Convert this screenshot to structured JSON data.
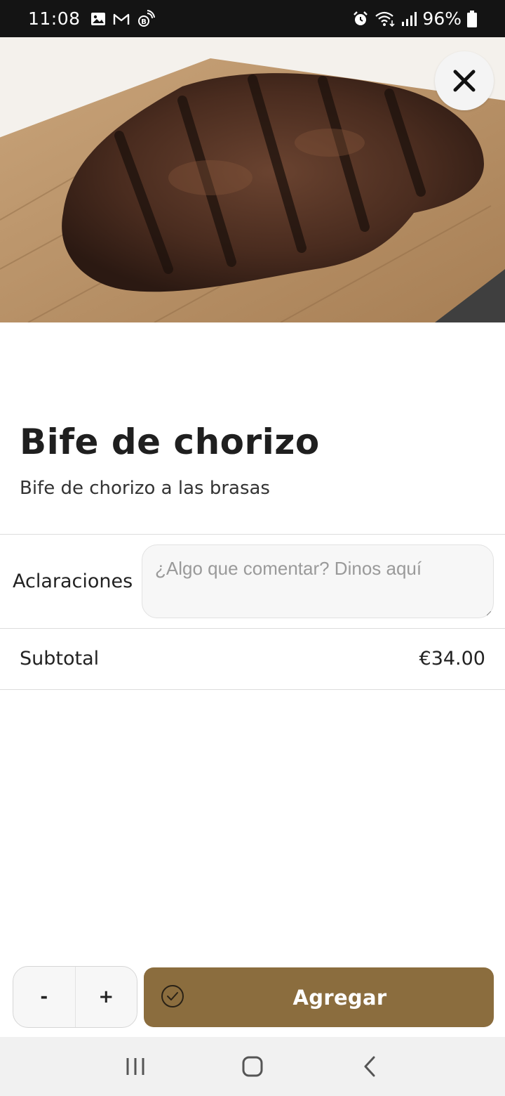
{
  "status_bar": {
    "time": "11:08",
    "battery_percent": "96%",
    "icons": [
      "gallery-icon",
      "gmail-icon",
      "bixby-routine-icon",
      "alarm-icon",
      "wifi-icon",
      "signal-icon",
      "battery-icon"
    ]
  },
  "hero": {
    "image_subject": "grilled steak on wooden board",
    "close_icon": "close-icon"
  },
  "product": {
    "name": "Bife de chorizo",
    "description": "Bife de chorizo a las brasas"
  },
  "notes": {
    "label": "Aclaraciones",
    "placeholder": "¿Algo que comentar? Dinos aquí",
    "value": ""
  },
  "subtotal": {
    "label": "Subtotal",
    "value": "€34.00"
  },
  "actions": {
    "decrement_label": "-",
    "increment_label": "+",
    "add_label": "Agregar",
    "add_icon": "check-circle-icon"
  },
  "navbar": {
    "icons": [
      "recent-apps-icon",
      "home-icon",
      "back-icon"
    ]
  },
  "colors": {
    "accent": "#8b6d3e",
    "status_bar_bg": "#141414",
    "nav_bar_bg": "#f1f1f1",
    "input_bg": "#f7f7f7"
  }
}
